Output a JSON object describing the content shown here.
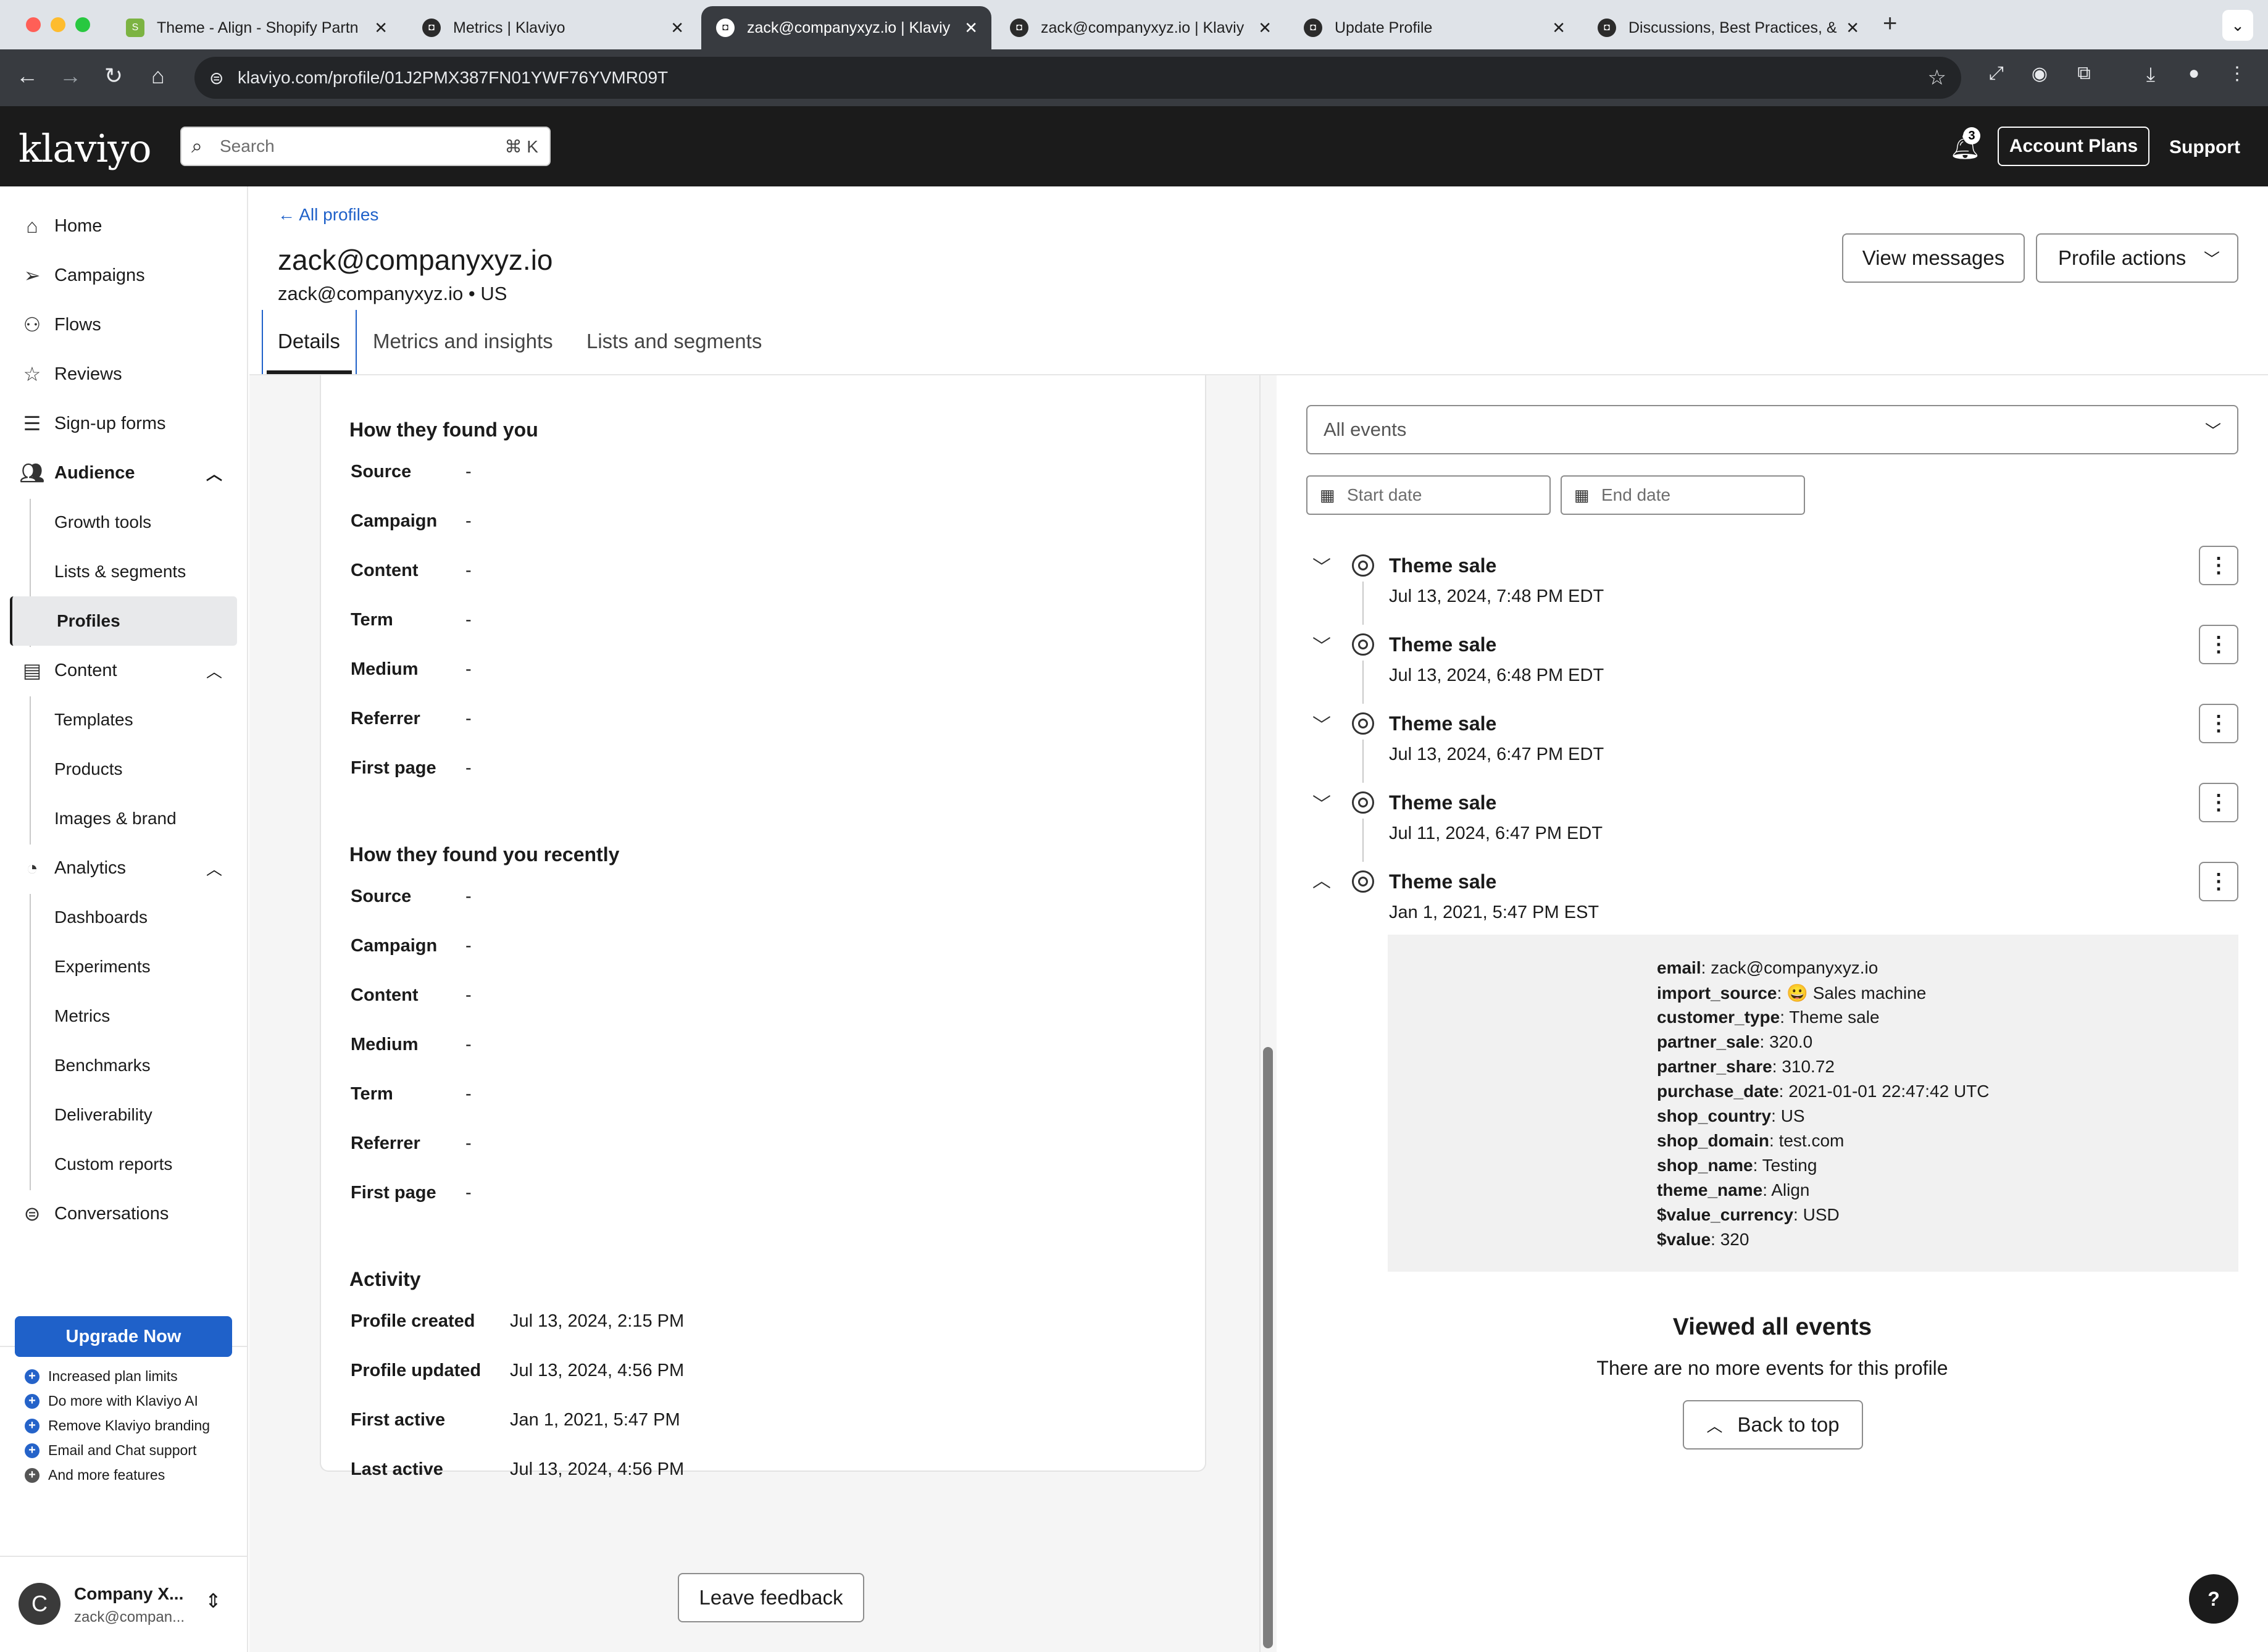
{
  "browser": {
    "tabs": [
      {
        "title": "Theme - Align - Shopify Partn",
        "icon": "shopify-icon"
      },
      {
        "title": "Metrics | Klaviyo",
        "icon": "klaviyo-icon"
      },
      {
        "title": "zack@companyxyz.io | Klaviy",
        "icon": "klaviyo-icon",
        "active": true
      },
      {
        "title": "zack@companyxyz.io | Klaviy",
        "icon": "klaviyo-icon"
      },
      {
        "title": "Update Profile",
        "icon": "klaviyo-icon"
      },
      {
        "title": "Discussions, Best Practices, &",
        "icon": "klaviyo-icon"
      }
    ],
    "url": "klaviyo.com/profile/01J2PMX387FN01YWF76YVMR09T"
  },
  "header": {
    "logo": "klaviyo",
    "search_placeholder": "Search",
    "search_shortcut": "⌘ K",
    "notification_count": "3",
    "account_plans": "Account Plans",
    "support": "Support"
  },
  "sidebar": {
    "home": "Home",
    "campaigns": "Campaigns",
    "flows": "Flows",
    "reviews": "Reviews",
    "signup_forms": "Sign-up forms",
    "audience": "Audience",
    "growth_tools": "Growth tools",
    "lists_segments": "Lists & segments",
    "profiles": "Profiles",
    "content": "Content",
    "templates": "Templates",
    "products": "Products",
    "images_brand": "Images & brand",
    "analytics": "Analytics",
    "dashboards": "Dashboards",
    "experiments": "Experiments",
    "metrics": "Metrics",
    "benchmarks": "Benchmarks",
    "deliverability": "Deliverability",
    "custom_reports": "Custom reports",
    "conversations": "Conversations",
    "features": [
      "Increased plan limits",
      "Do more with Klaviyo AI",
      "Remove Klaviyo branding",
      "Email and Chat support",
      "And more features"
    ],
    "upgrade": "Upgrade Now",
    "account_initial": "C",
    "account_name": "Company X...",
    "account_email": "zack@compan..."
  },
  "profile": {
    "back": "All profiles",
    "title": "zack@companyxyz.io",
    "subtitle": "zack@companyxyz.io • US",
    "view_messages": "View messages",
    "profile_actions": "Profile actions",
    "tabs": [
      "Details",
      "Metrics and insights",
      "Lists and segments"
    ]
  },
  "found_you": {
    "heading": "How they found you",
    "rows": [
      {
        "label": "Source",
        "value": "-"
      },
      {
        "label": "Campaign",
        "value": "-"
      },
      {
        "label": "Content",
        "value": "-"
      },
      {
        "label": "Term",
        "value": "-"
      },
      {
        "label": "Medium",
        "value": "-"
      },
      {
        "label": "Referrer",
        "value": "-"
      },
      {
        "label": "First page",
        "value": "-"
      }
    ]
  },
  "found_recently": {
    "heading": "How they found you recently",
    "rows": [
      {
        "label": "Source",
        "value": "-"
      },
      {
        "label": "Campaign",
        "value": "-"
      },
      {
        "label": "Content",
        "value": "-"
      },
      {
        "label": "Medium",
        "value": "-"
      },
      {
        "label": "Term",
        "value": "-"
      },
      {
        "label": "Referrer",
        "value": "-"
      },
      {
        "label": "First page",
        "value": "-"
      }
    ]
  },
  "activity": {
    "heading": "Activity",
    "rows": [
      {
        "label": "Profile created",
        "value": "Jul 13, 2024, 2:15 PM"
      },
      {
        "label": "Profile updated",
        "value": "Jul 13, 2024, 4:56 PM"
      },
      {
        "label": "First active",
        "value": "Jan 1, 2021, 5:47 PM"
      },
      {
        "label": "Last active",
        "value": "Jul 13, 2024, 4:56 PM"
      }
    ]
  },
  "leave_feedback": "Leave feedback",
  "events": {
    "filter": "All events",
    "start_date": "Start date",
    "end_date": "End date",
    "items": [
      {
        "title": "Theme sale",
        "date": "Jul 13, 2024, 7:48 PM EDT"
      },
      {
        "title": "Theme sale",
        "date": "Jul 13, 2024, 6:48 PM EDT"
      },
      {
        "title": "Theme sale",
        "date": "Jul 13, 2024, 6:47 PM EDT"
      },
      {
        "title": "Theme sale",
        "date": "Jul 11, 2024, 6:47 PM EDT"
      },
      {
        "title": "Theme sale",
        "date": "Jan 1, 2021, 5:47 PM EST"
      }
    ],
    "properties": [
      {
        "key": "email",
        "value": "zack@companyxyz.io"
      },
      {
        "key": "import_source",
        "value": "😀 Sales machine"
      },
      {
        "key": "customer_type",
        "value": "Theme sale"
      },
      {
        "key": "partner_sale",
        "value": "320.0"
      },
      {
        "key": "partner_share",
        "value": "310.72"
      },
      {
        "key": "purchase_date",
        "value": "2021-01-01 22:47:42 UTC"
      },
      {
        "key": "shop_country",
        "value": "US"
      },
      {
        "key": "shop_domain",
        "value": "test.com"
      },
      {
        "key": "shop_name",
        "value": "Testing"
      },
      {
        "key": "theme_name",
        "value": "Align"
      },
      {
        "key": "$value_currency",
        "value": "USD"
      },
      {
        "key": "$value",
        "value": "320"
      }
    ],
    "viewed_all": "Viewed all events",
    "no_more": "There are no more events for this profile",
    "back_to_top": "Back to top"
  },
  "help": "?"
}
